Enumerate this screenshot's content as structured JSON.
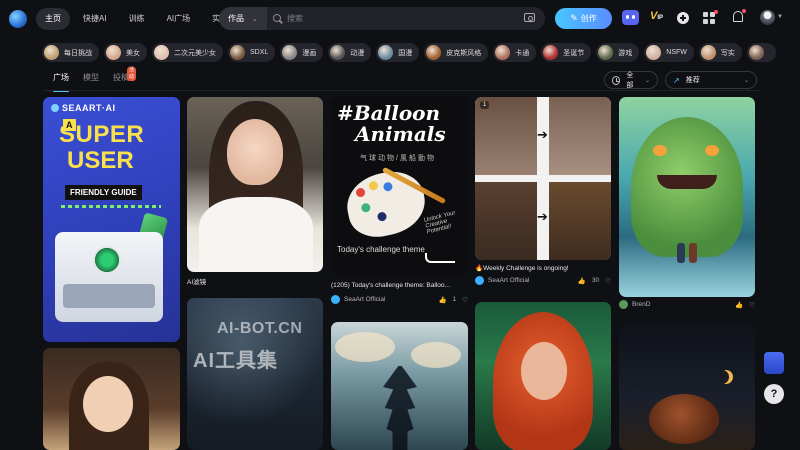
{
  "nav": {
    "items": [
      "主页",
      "快捷AI",
      "训练",
      "AI广场",
      "实验室"
    ],
    "active_index": 0
  },
  "search": {
    "type_label": "作品",
    "placeholder": "搜索"
  },
  "header": {
    "create_label": "创作",
    "vip_label": "V",
    "vip_sub": "IP"
  },
  "tags": [
    {
      "label": "每日挑战",
      "color": "#c0a070"
    },
    {
      "label": "美女",
      "color": "#d8a890"
    },
    {
      "label": "二次元美少女",
      "color": "#e0c0b0"
    },
    {
      "label": "SDXL",
      "color": "#7a5a40"
    },
    {
      "label": "漫画",
      "color": "#888888"
    },
    {
      "label": "动漫",
      "color": "#555555"
    },
    {
      "label": "国漫",
      "color": "#6a8aa0"
    },
    {
      "label": "皮克斯风格",
      "color": "#a06030"
    },
    {
      "label": "卡通",
      "color": "#b07060"
    },
    {
      "label": "圣诞节",
      "color": "#b03030"
    },
    {
      "label": "游戏",
      "color": "#5a6a4a"
    },
    {
      "label": "NSFW",
      "color": "#d0b0a0"
    },
    {
      "label": "写实",
      "color": "#c09070"
    },
    {
      "label": "",
      "color": "#7a6050"
    }
  ],
  "tabs": [
    {
      "label": "广场",
      "active": true
    },
    {
      "label": "模型",
      "active": false
    },
    {
      "label": "投稿",
      "active": false,
      "badge": "活动"
    }
  ],
  "filters": {
    "time_label": "全部",
    "sort_label": "推荐"
  },
  "cards": {
    "c1": {
      "brand": "SEAART·AI",
      "big_a": "A",
      "line1": "SUPER",
      "line2": "USER",
      "line3": "FRIENDLY GUIDE"
    },
    "c2": {
      "caption": "AI滤镜"
    },
    "c3": {
      "title1": "#Balloon",
      "title2": "Animals",
      "subtitle": "气球动物/風船動物",
      "unlock": "Unlock Your Creative Potential!",
      "today": "Today's challenge theme",
      "caption": "(1205) Today's challenge theme: Balloo...",
      "user": "SeaArt Official",
      "likes": "1"
    },
    "c4": {
      "count": "1",
      "caption": "🔥Weekly Challenge is ongoing!",
      "user": "SeaArt Official",
      "likes": "30"
    },
    "c5": {
      "user": "BrenD"
    }
  },
  "watermark": {
    "line1": "AI-BOT.CN",
    "line2": "AI工具集"
  },
  "side": {
    "help_label": "?"
  },
  "colors": {
    "accent": "#4fc3ff",
    "background": "#0f1014",
    "create_gradient_start": "#47c6ff",
    "create_gradient_end": "#5b8cff"
  }
}
